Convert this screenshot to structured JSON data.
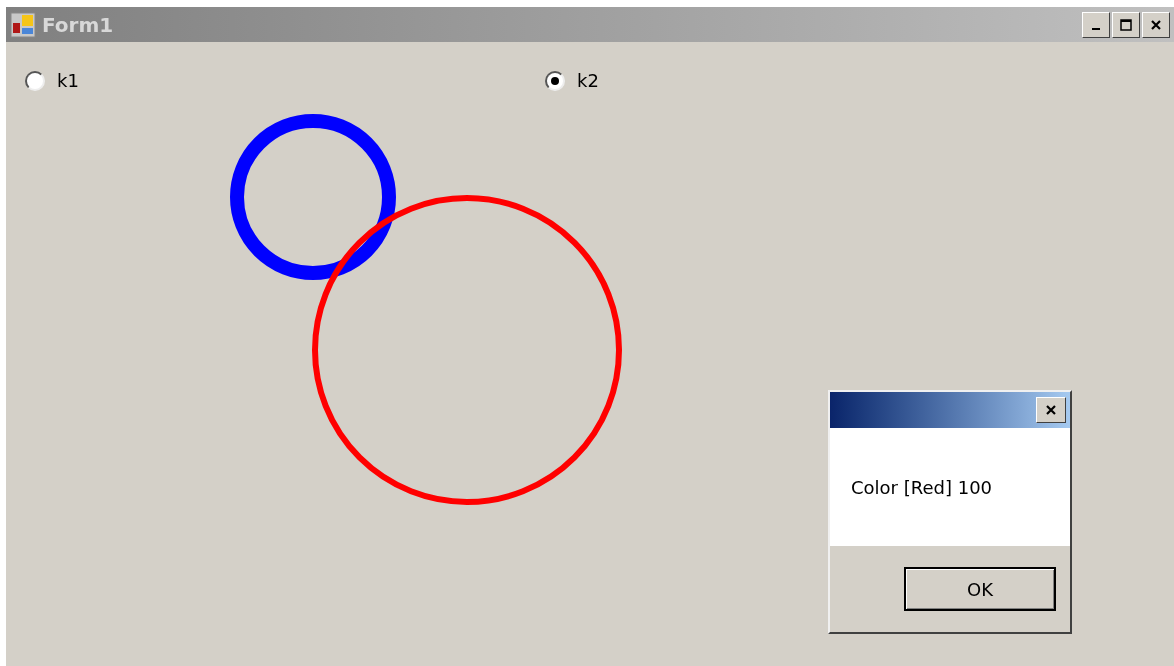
{
  "window": {
    "title": "Form1"
  },
  "title_buttons": [
    {
      "kind": "minimize"
    },
    {
      "kind": "maximize"
    },
    {
      "kind": "close"
    }
  ],
  "radios": [
    {
      "label": "k1",
      "selected": false
    },
    {
      "label": "k2",
      "selected": true
    }
  ],
  "circles": [
    {
      "color": "#0000ff"
    },
    {
      "color": "#ff0000"
    }
  ],
  "dialog": {
    "message": "Color [Red] 100",
    "button": "OK"
  }
}
